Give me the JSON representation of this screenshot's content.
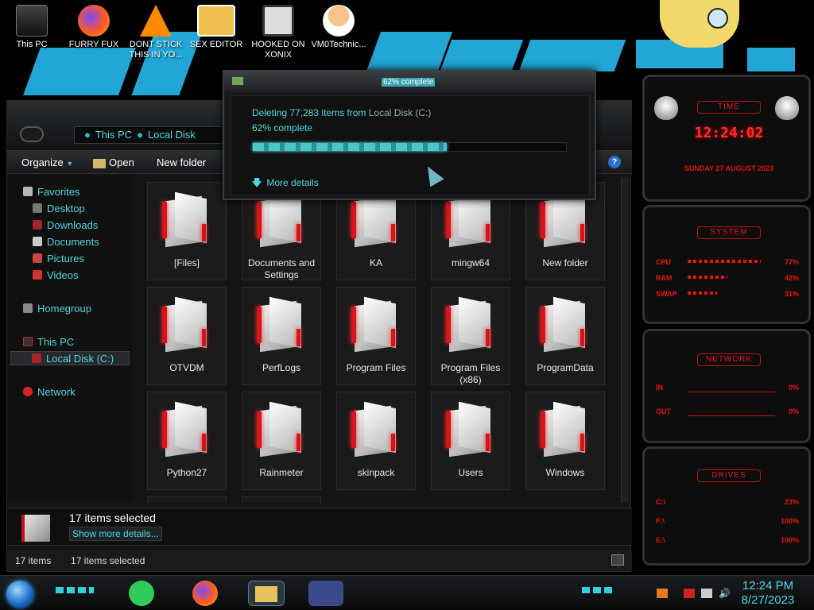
{
  "desktop": {
    "icons": [
      {
        "label": "This PC"
      },
      {
        "label": "FURRY FUX"
      },
      {
        "label": "DONT STICK THIS IN YO..."
      },
      {
        "label": "SEX EDITOR"
      },
      {
        "label": "HOOKED ON XONIX"
      },
      {
        "label": "VM0Technic..."
      }
    ]
  },
  "explorer": {
    "breadcrumb": [
      "This PC",
      "Local Disk"
    ],
    "toolbar": {
      "organize": "Organize",
      "open": "Open",
      "new_folder": "New folder"
    },
    "nav": {
      "favorites": "Favorites",
      "desktop": "Desktop",
      "downloads": "Downloads",
      "documents": "Documents",
      "pictures": "Pictures",
      "videos": "Videos",
      "homegroup": "Homegroup",
      "this_pc": "This PC",
      "local_disk": "Local Disk (C:)",
      "network": "Network"
    },
    "items": [
      "[Files]",
      "Documents and Settings",
      "KA",
      "mingw64",
      "New folder",
      "OTVDM",
      "PerfLogs",
      "Program Files",
      "Program Files (x86)",
      "ProgramData",
      "Python27",
      "Rainmeter",
      "skinpack",
      "Users",
      "Windows"
    ],
    "details": {
      "count": "17 items selected",
      "more": "Show more details..."
    },
    "status": {
      "items": "17 items",
      "selected": "17 items selected"
    }
  },
  "dialog": {
    "title": "62% complete",
    "line1_prefix": "Deleting 77,283 items from ",
    "line1_source": "Local Disk (C:)",
    "line2": "62% complete",
    "progress": 0.62,
    "more_details": "More details"
  },
  "gadgets": {
    "time": {
      "title": "TIME",
      "clock": "12:24:02",
      "date": "SUNDAY 27 AUGUST 2023"
    },
    "system": {
      "title": "SYSTEM",
      "rows": [
        {
          "label": "CPU",
          "value": "77%",
          "level": 0.77
        },
        {
          "label": "RAM",
          "value": "42%",
          "level": 0.42
        },
        {
          "label": "SWAP",
          "value": "31%",
          "level": 0.31
        }
      ]
    },
    "network": {
      "title": "NETWORK",
      "rows": [
        {
          "label": "IN",
          "value": "0%"
        },
        {
          "label": "OUT",
          "value": "0%"
        }
      ]
    },
    "drives": {
      "title": "DRIVES",
      "rows": [
        {
          "label": "C:\\",
          "value": "23%"
        },
        {
          "label": "F:\\",
          "value": "100%"
        },
        {
          "label": "E:\\",
          "value": "100%"
        }
      ]
    }
  },
  "taskbar": {
    "time": "12:24 PM",
    "date": "8/27/2023"
  },
  "colors": {
    "accent": "#4fd6e0",
    "alert": "#e8141b",
    "folder_red": "#d6141c"
  }
}
